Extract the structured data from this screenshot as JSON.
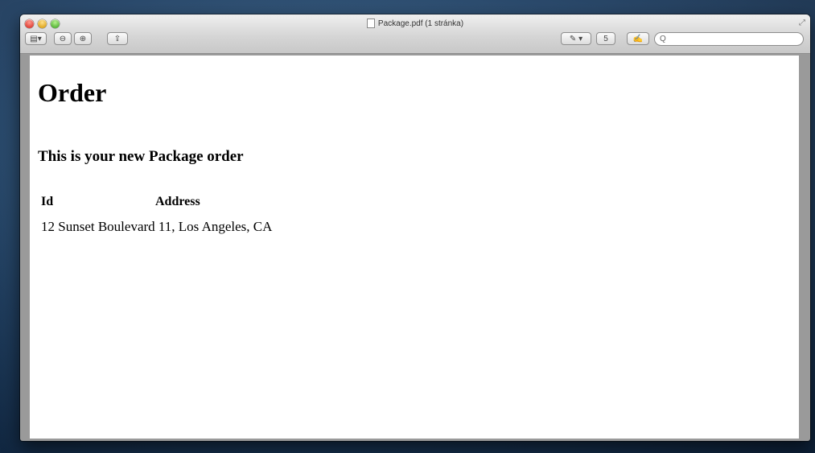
{
  "window": {
    "title": "Package.pdf (1 stránka)"
  },
  "toolbar": {
    "sidebar_label": "▤▾",
    "zoom_out_label": "⊖",
    "zoom_in_label": "⊕",
    "share_label": "⇪",
    "annotate_label": "✎ ▾",
    "text_tool_label": "5",
    "sign_label": "✍",
    "search_placeholder": "Q"
  },
  "document": {
    "heading": "Order",
    "subheading": "This is your new Package order",
    "table": {
      "headers": [
        "Id",
        "Address"
      ],
      "rows": [
        [
          "12",
          "Sunset Boulevard 11, Los Angeles, CA"
        ]
      ]
    }
  },
  "colors": {
    "close": "#e0443a",
    "minimize": "#e0a923",
    "zoom": "#5ab83b"
  }
}
